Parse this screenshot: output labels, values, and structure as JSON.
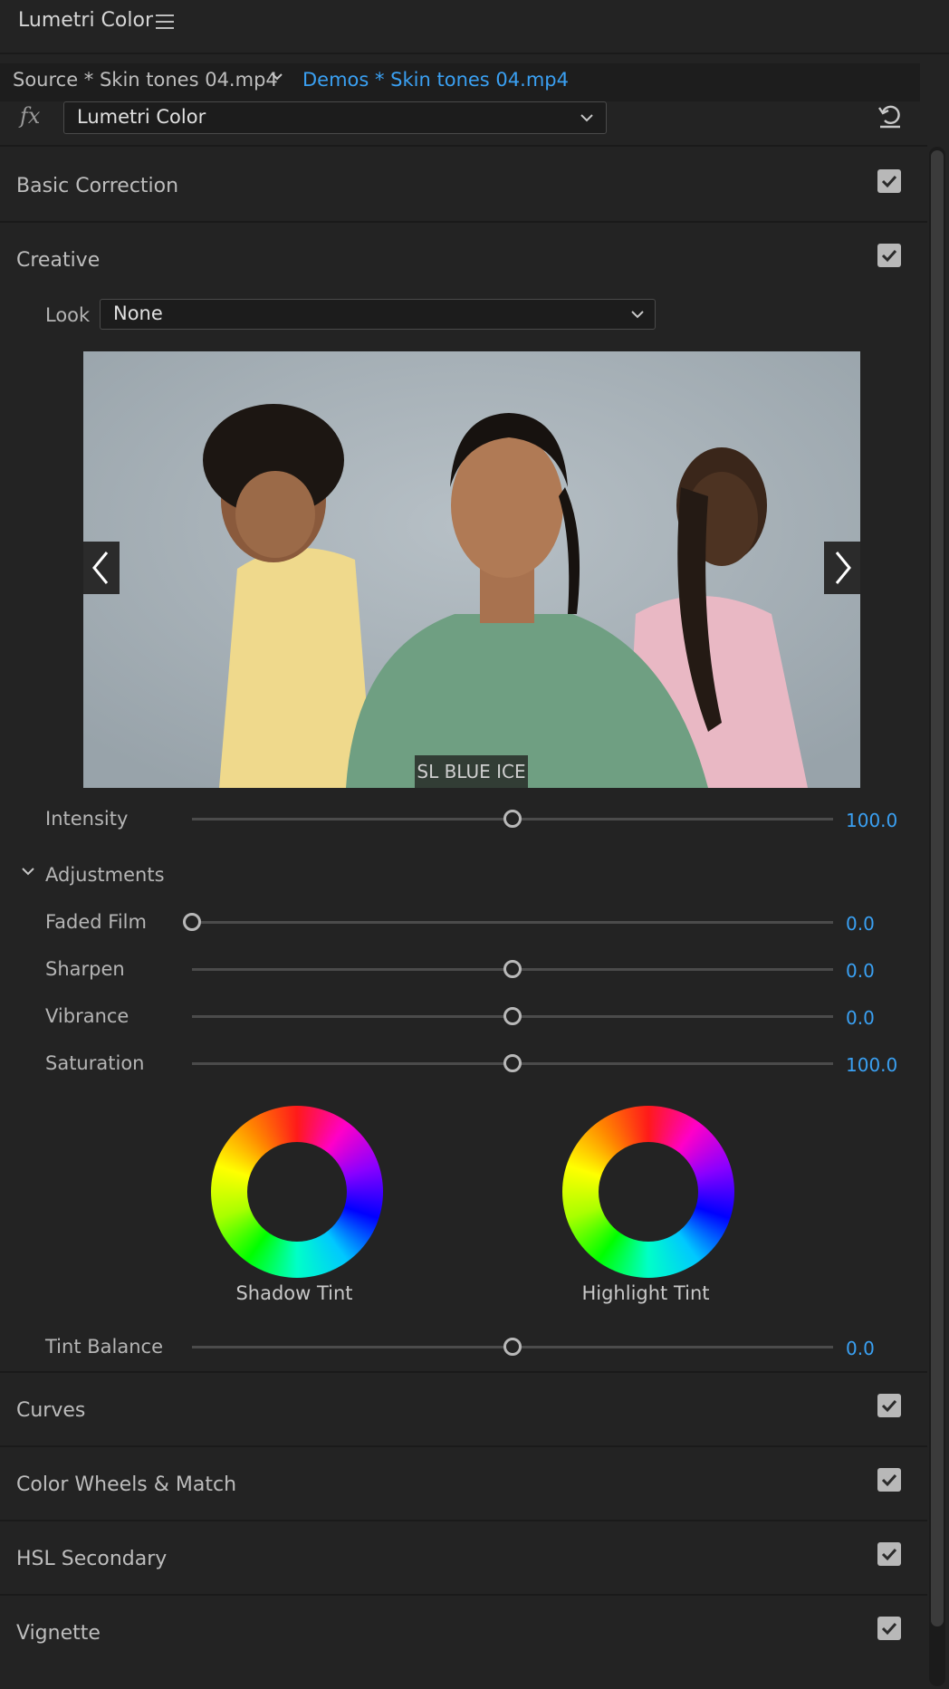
{
  "panel": {
    "title": "Lumetri Color"
  },
  "source": {
    "label": "Source * Skin tones 04.mp4",
    "demos": "Demos * Skin tones 04.mp4"
  },
  "effect": {
    "fx": "fx",
    "selected": "Lumetri Color"
  },
  "sections": {
    "basic": "Basic Correction",
    "creative": "Creative",
    "curves": "Curves",
    "color_wheels": "Color Wheels & Match",
    "hsl": "HSL Secondary",
    "vignette": "Vignette"
  },
  "creative": {
    "look_label": "Look",
    "look_value": "None",
    "preview_look_name": "SL BLUE ICE",
    "intensity": {
      "label": "Intensity",
      "value": "100.0",
      "level": 0.5
    },
    "adjustments_label": "Adjustments",
    "faded_film": {
      "label": "Faded Film",
      "value": "0.0",
      "level": 0.0
    },
    "sharpen": {
      "label": "Sharpen",
      "value": "0.0",
      "level": 0.5
    },
    "vibrance": {
      "label": "Vibrance",
      "value": "0.0",
      "level": 0.5
    },
    "saturation": {
      "label": "Saturation",
      "value": "100.0",
      "level": 0.5
    },
    "shadow_tint": "Shadow Tint",
    "highlight_tint": "Highlight Tint",
    "tint_balance": {
      "label": "Tint Balance",
      "value": "0.0",
      "level": 0.5
    }
  },
  "colors": {
    "accent": "#3aa0f2",
    "background": "#232323"
  }
}
